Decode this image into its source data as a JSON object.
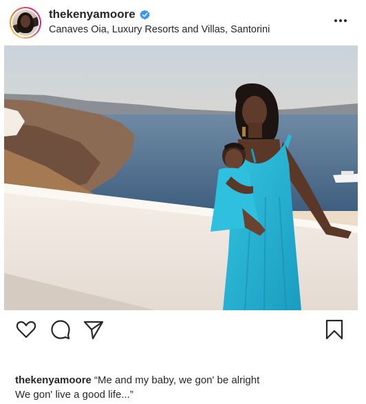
{
  "post": {
    "username": "thekenyamoore",
    "verified": true,
    "location": "Canaves Oia, Luxury Resorts and Villas, Santorini",
    "more_icon": "more-horizontal-icon",
    "photo_icon": "photo",
    "caption_user": "thekenyamoore",
    "caption_line1": "“Me and my baby, we gon' be alright",
    "caption_line2": "We gon' live a good life...”"
  },
  "actions": {
    "like_icon": "heart-icon",
    "comment_icon": "comment-icon",
    "share_icon": "paper-plane-icon",
    "save_icon": "bookmark-icon"
  },
  "colors": {
    "text": "#262626",
    "verified_blue": "#3897f0",
    "dress_teal": "#22b5d6"
  }
}
